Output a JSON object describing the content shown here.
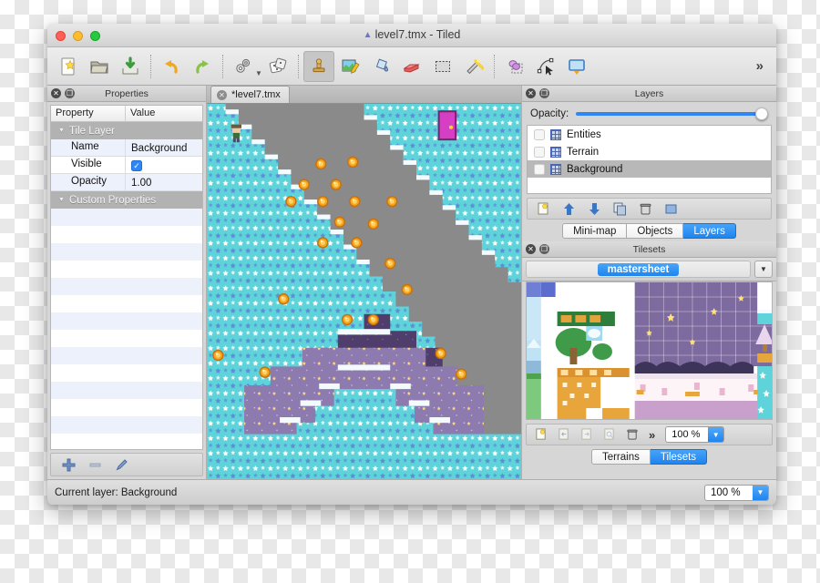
{
  "window": {
    "title": "level7.tmx - Tiled",
    "title_icon": "tiled-logo-icon",
    "traffic_lights": [
      "close",
      "minimize",
      "zoom"
    ]
  },
  "toolbar": {
    "items": [
      {
        "name": "new-map-button",
        "icon": "new-document-icon",
        "label": "New"
      },
      {
        "name": "open-map-button",
        "icon": "open-folder-icon",
        "label": "Open"
      },
      {
        "name": "save-map-button",
        "icon": "save-disk-icon",
        "label": "Save"
      },
      {
        "name": "undo-button",
        "icon": "undo-arrow-icon",
        "label": "Undo"
      },
      {
        "name": "redo-button",
        "icon": "redo-arrow-icon",
        "label": "Redo"
      },
      {
        "name": "map-properties-button",
        "icon": "gears-icon",
        "label": "Map Properties"
      },
      {
        "name": "random-mode-button",
        "icon": "dice-icon",
        "label": "Random Mode"
      },
      {
        "name": "stamp-brush-tool",
        "icon": "stamp-icon",
        "label": "Stamp Brush",
        "active": true
      },
      {
        "name": "terrain-brush-tool",
        "icon": "terrain-pencil-icon",
        "label": "Terrain Brush"
      },
      {
        "name": "bucket-fill-tool",
        "icon": "paint-bucket-icon",
        "label": "Bucket Fill"
      },
      {
        "name": "eraser-tool",
        "icon": "eraser-icon",
        "label": "Eraser"
      },
      {
        "name": "rectangular-select-tool",
        "icon": "rectangle-select-icon",
        "label": "Rectangular Select"
      },
      {
        "name": "magic-wand-tool",
        "icon": "magic-wand-icon",
        "label": "Magic Wand"
      },
      {
        "name": "select-objects-tool",
        "icon": "select-objects-icon",
        "label": "Select Objects"
      },
      {
        "name": "edit-polygons-tool",
        "icon": "edit-polygons-icon",
        "label": "Edit Polygons"
      },
      {
        "name": "insert-rectangle-tool",
        "icon": "insert-rectangle-icon",
        "label": "Insert Rectangle"
      }
    ],
    "overflow_label": "»"
  },
  "properties_panel": {
    "title": "Properties",
    "close_glyph": "✕",
    "float_glyph": "❐",
    "columns": [
      "Property",
      "Value"
    ],
    "groups": [
      {
        "label": "Tile Layer",
        "rows": [
          {
            "key": "Name",
            "value": "Background",
            "type": "text"
          },
          {
            "key": "Visible",
            "value": "✓",
            "type": "checkbox",
            "checked": true
          },
          {
            "key": "Opacity",
            "value": "1.00",
            "type": "text"
          }
        ]
      },
      {
        "label": "Custom Properties",
        "rows": []
      }
    ],
    "tools": [
      {
        "name": "add-property-button",
        "icon": "plus-icon",
        "glyph": "＋"
      },
      {
        "name": "remove-property-button",
        "icon": "minus-icon",
        "glyph": "–"
      },
      {
        "name": "edit-property-button",
        "icon": "pencil-icon",
        "glyph": "╱"
      }
    ]
  },
  "document_tabs": [
    {
      "label": "*level7.tmx",
      "close_glyph": "✕",
      "active": true
    }
  ],
  "layers_panel": {
    "title": "Layers",
    "opacity_label": "Opacity:",
    "opacity_value": 100,
    "layers": [
      {
        "name": "Entities",
        "visible": false,
        "selected": false
      },
      {
        "name": "Terrain",
        "visible": false,
        "selected": false
      },
      {
        "name": "Background",
        "visible": false,
        "selected": true
      }
    ],
    "tools": [
      {
        "name": "new-layer-button",
        "icon": "new-layer-icon"
      },
      {
        "name": "raise-layer-button",
        "icon": "arrow-up-icon"
      },
      {
        "name": "lower-layer-button",
        "icon": "arrow-down-icon"
      },
      {
        "name": "duplicate-layer-button",
        "icon": "duplicate-icon"
      },
      {
        "name": "delete-layer-button",
        "icon": "trash-icon"
      },
      {
        "name": "layer-properties-button",
        "icon": "properties-icon"
      }
    ],
    "tabs": [
      {
        "label": "Mini-map",
        "active": false
      },
      {
        "label": "Objects",
        "active": false
      },
      {
        "label": "Layers",
        "active": true
      }
    ]
  },
  "tilesets_panel": {
    "title": "Tilesets",
    "active_tileset": "mastersheet",
    "dropdown_glyph": "▼",
    "zoom_value": "100 %",
    "tools": [
      {
        "name": "new-tileset-button",
        "icon": "new-tileset-icon"
      },
      {
        "name": "embed-tileset-button",
        "icon": "embed-tileset-icon"
      },
      {
        "name": "export-tileset-button",
        "icon": "export-tileset-icon"
      },
      {
        "name": "edit-tileset-button",
        "icon": "edit-tileset-icon"
      },
      {
        "name": "remove-tileset-button",
        "icon": "trash-icon"
      },
      {
        "name": "more-tileset-options-button",
        "icon": "chevron-double-right-icon",
        "glyph": "»"
      }
    ],
    "tabs": [
      {
        "label": "Terrains",
        "active": false
      },
      {
        "label": "Tilesets",
        "active": true
      }
    ]
  },
  "statusbar": {
    "text": "Current layer: Background",
    "zoom_value": "100 %"
  },
  "map_canvas": {
    "description": "Tiled map view showing a starry cyan sky tileset with grey cavern, purple night region, snow-capped platforms, orange coin pickups and a character sprite",
    "background_color": "#8a8a8a",
    "colors": {
      "sky_cyan": "#5fd3da",
      "cavern_grey": "#8a8a8a",
      "night_purple": "#8d7aae",
      "deep_purple": "#4f3d6b",
      "snow_white": "#f4fbff",
      "coin_orange": "#f3a01c",
      "portal_pink": "#d63fc4"
    }
  }
}
